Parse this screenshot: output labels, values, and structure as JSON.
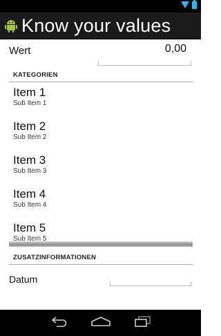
{
  "app": {
    "title": "Know your values"
  },
  "wert": {
    "label": "Wert",
    "value": "0,00"
  },
  "kategorien": {
    "header": "KATEGORIEN",
    "items": [
      {
        "title": "Item 1",
        "subtitle": "Sub Item 1"
      },
      {
        "title": "Item 2",
        "subtitle": "Sub Item 2"
      },
      {
        "title": "Item 3",
        "subtitle": "Sub Item 3"
      },
      {
        "title": "Item 4",
        "subtitle": "Sub Item 4"
      },
      {
        "title": "Item 5",
        "subtitle": "Sub Item 5"
      }
    ]
  },
  "zusatz": {
    "header": "ZUSATZINFORMATIONEN",
    "datum_label": "Datum",
    "datum_value": ""
  },
  "icons": {
    "status": [
      "wifi-icon",
      "battery-icon"
    ],
    "app": "android-robot-icon",
    "nav": [
      "back-icon",
      "home-icon",
      "recent-apps-icon"
    ]
  },
  "colors": {
    "appbar": "#1a1a1a",
    "statusbar": "#000000",
    "status_icons": "#33b5e5"
  }
}
